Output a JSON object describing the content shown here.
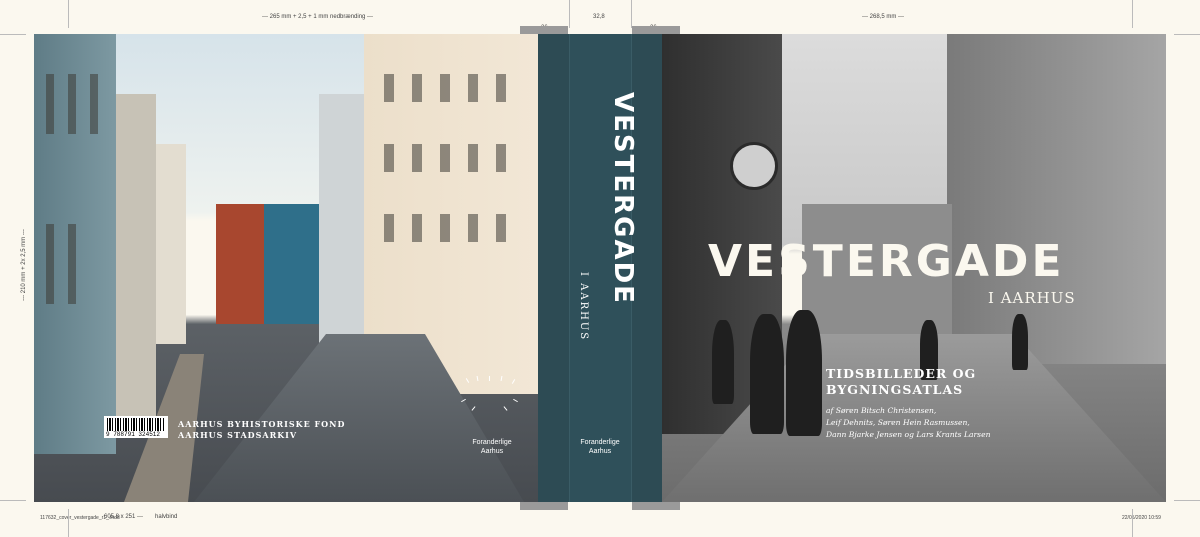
{
  "print_marks": {
    "back_width": "--- 265 mm + 2,5 + 1 mm nedbrænding ---",
    "spine_width": "32,8",
    "front_width": "--- 268,5 mm ---",
    "height": "--- 210 mm + 2x 2,5 mm ---",
    "flap_left": "26",
    "flap_right": "26",
    "file_name": "117632_cover_vestergade_r1_.indd",
    "size": "605,8 x 251 ---",
    "binding": "halvbind",
    "timestamp": "22/05/2020 10:59"
  },
  "spine": {
    "title": "VESTERGADE",
    "subtitle": "I AARHUS",
    "series": [
      "Foranderlige",
      "Aarhus"
    ]
  },
  "front": {
    "title": "VESTERGADE",
    "subtitle": "I AARHUS",
    "tagline_1": "TIDSBILLEDER OG",
    "tagline_2": "BYGNINGSATLAS",
    "authors": [
      "af Søren Bitsch Christensen,",
      "Leif Dehnits, Søren Hein Rasmussen,",
      "Dann Bjarke Jensen og Lars Krants Larsen"
    ]
  },
  "back": {
    "isbn": "9 788791 324512",
    "publisher_1": "AARHUS BYHISTORISKE FOND",
    "publisher_2": "AARHUS STADSARKIV",
    "series": [
      "Foranderlige",
      "Aarhus"
    ]
  },
  "colors": {
    "spine": "#2d4b54",
    "paper": "#fbf8ef"
  }
}
